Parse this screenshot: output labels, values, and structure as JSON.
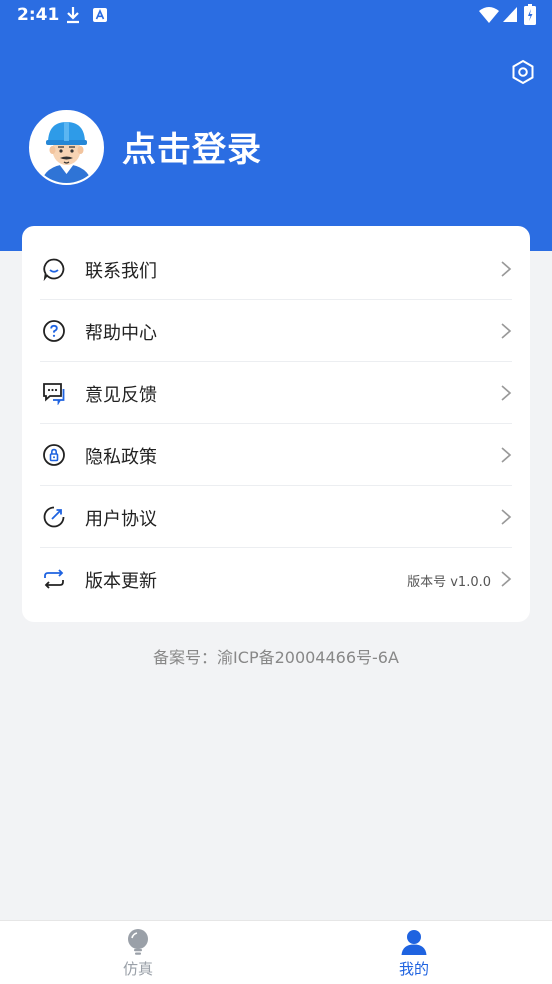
{
  "status_bar": {
    "time": "2:41",
    "icons": [
      "download-icon",
      "a-icon",
      "wifi-icon",
      "signal-icon",
      "battery-icon"
    ]
  },
  "header": {
    "login_label": "点击登录",
    "settings_icon": "gear-icon",
    "background": "#2b6de2"
  },
  "menu": {
    "items": [
      {
        "label": "联系我们",
        "icon": "chat-bubble-icon"
      },
      {
        "label": "帮助中心",
        "icon": "help-icon"
      },
      {
        "label": "意见反馈",
        "icon": "feedback-icon"
      },
      {
        "label": "隐私政策",
        "icon": "privacy-lock-icon"
      },
      {
        "label": "用户协议",
        "icon": "agreement-icon"
      },
      {
        "label": "版本更新",
        "icon": "refresh-icon",
        "value": "版本号 v1.0.0"
      }
    ]
  },
  "icp_text": "备案号：渝ICP备20004466号-6A",
  "tabs": [
    {
      "label": "仿真",
      "icon": "lightbulb-icon",
      "active": false,
      "color": "#9aa0a8"
    },
    {
      "label": "我的",
      "icon": "person-icon",
      "active": true,
      "color": "#1f63e0"
    }
  ]
}
